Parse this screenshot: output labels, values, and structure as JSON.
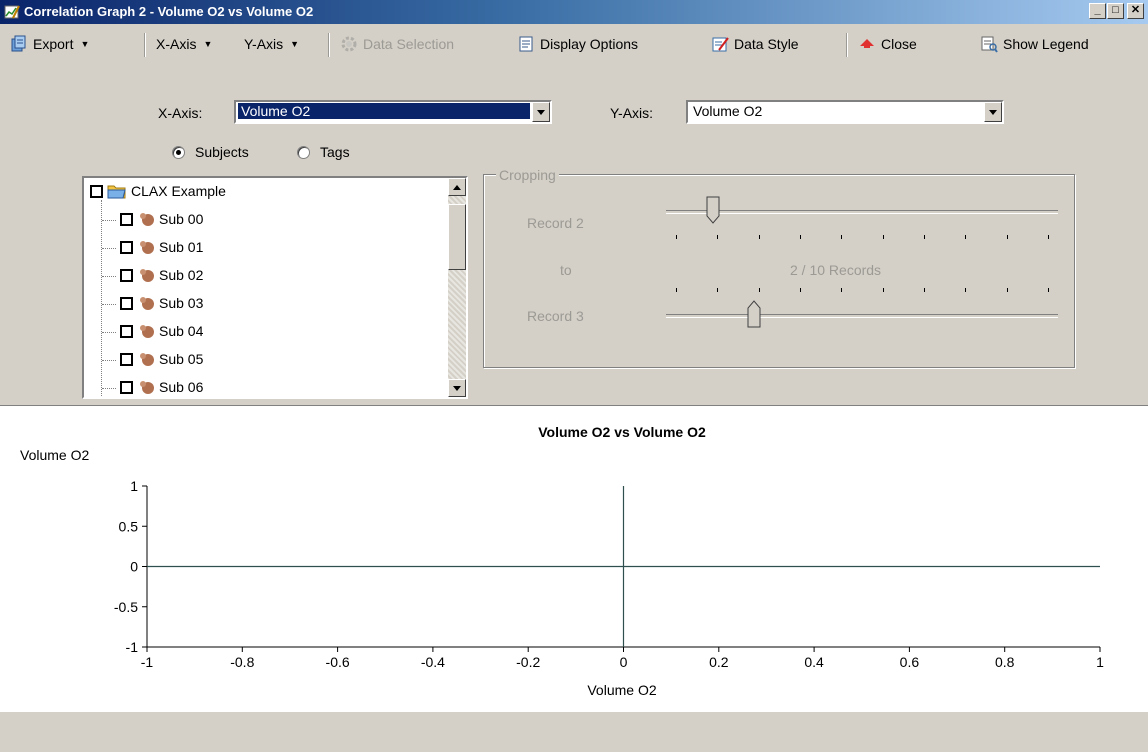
{
  "window": {
    "title": "Correlation Graph 2 - Volume O2 vs Volume O2"
  },
  "toolbar": {
    "export": "Export",
    "x_axis": "X-Axis",
    "y_axis": "Y-Axis",
    "data_selection": "Data Selection",
    "display_options": "Display Options",
    "data_style": "Data Style",
    "close": "Close",
    "show_legend": "Show Legend"
  },
  "axes": {
    "x_label": "X-Axis:",
    "x_value": "Volume O2",
    "y_label": "Y-Axis:",
    "y_value": "Volume O2"
  },
  "mode": {
    "subjects": "Subjects",
    "tags": "Tags",
    "selected": "subjects"
  },
  "tree": {
    "root": "CLAX Example",
    "items": [
      "Sub 00",
      "Sub 01",
      "Sub 02",
      "Sub 03",
      "Sub 04",
      "Sub 05",
      "Sub 06"
    ]
  },
  "cropping": {
    "title": "Cropping",
    "start_label": "Record 2",
    "to_label": "to",
    "end_label": "Record 3",
    "summary": "2 / 10 Records",
    "total_records": 10,
    "start_record": 2,
    "end_record": 3
  },
  "icons": {
    "title": "chart-pencil-icon",
    "export": "export-icon",
    "data_selection": "gear-icon",
    "display_options": "display-options-icon",
    "data_style": "data-style-icon",
    "close": "close-arrow-icon",
    "show_legend": "legend-icon",
    "root": "folder-icon",
    "subject": "subject-icon"
  },
  "chart_data": {
    "type": "scatter",
    "title": "Volume O2 vs Volume O2",
    "xlabel": "Volume O2",
    "ylabel": "Volume O2",
    "xlim": [
      -1,
      1
    ],
    "ylim": [
      -1,
      1
    ],
    "x_ticks": [
      "-1",
      "-0.8",
      "-0.6",
      "-0.4",
      "-0.2",
      "0",
      "0.2",
      "0.4",
      "0.6",
      "0.8",
      "1"
    ],
    "y_ticks": [
      "1",
      "0.5",
      "0",
      "-0.5",
      "-1"
    ],
    "series": [],
    "grid": false,
    "reference_lines": {
      "x": 0,
      "y": 0,
      "color": "#2f4f4f"
    }
  }
}
